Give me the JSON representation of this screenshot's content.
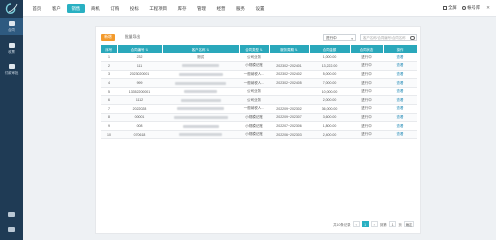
{
  "sidebar": {
    "items": [
      {
        "label": "合同",
        "icon": "contract-icon"
      },
      {
        "label": "收票",
        "icon": "invoice-icon"
      },
      {
        "label": "付款审批",
        "icon": "payment-icon"
      }
    ]
  },
  "nav": {
    "items": [
      "首页",
      "客户",
      "销售",
      "商机",
      "订购",
      "投标",
      "工程项目",
      "库存",
      "管理",
      "经营",
      "服务",
      "设置"
    ],
    "active_index": 2
  },
  "top_right": {
    "fullscreen": "全屏",
    "account": "帐号库"
  },
  "toolbar": {
    "add_label": "新增",
    "export_label": "批量导出"
  },
  "filter": {
    "status_value": "进行中"
  },
  "search": {
    "placeholder": "客户名称/合同编号/合同名称"
  },
  "table": {
    "columns": [
      "序号",
      "合同编号",
      "客户名称",
      "合同类型",
      "服务周期",
      "合同金额",
      "合同状态",
      "操作"
    ],
    "rows": [
      {
        "no": "1",
        "code": "232",
        "customer": "测试",
        "blur": false,
        "type": "公司业务",
        "period": "",
        "amount": "1,000.00",
        "status": "进行中",
        "op": "查看"
      },
      {
        "no": "2",
        "code": "111",
        "customer": "",
        "blur": true,
        "type": "小规模记账",
        "period": "202302~202401",
        "amount": "13,222.00",
        "status": "进行中",
        "op": "查看"
      },
      {
        "no": "3",
        "code": "2023020001",
        "customer": "",
        "blur": true,
        "type": "一般纳税人...",
        "period": "202302~202402",
        "amount": "5,000.00",
        "status": "进行中",
        "op": "查看"
      },
      {
        "no": "4",
        "code": "999",
        "customer": "",
        "blur": true,
        "type": "一般纳税人...",
        "period": "202302~202405",
        "amount": "7,000.00",
        "status": "进行中",
        "op": "查看"
      },
      {
        "no": "5",
        "code": "13352200001",
        "customer": "",
        "blur": true,
        "type": "公司业务",
        "period": "",
        "amount": "10,000.00",
        "status": "进行中",
        "op": "查看"
      },
      {
        "no": "6",
        "code": "1112",
        "customer": "",
        "blur": true,
        "type": "公司业务",
        "period": "",
        "amount": "2,000.00",
        "status": "进行中",
        "op": "查看"
      },
      {
        "no": "7",
        "code": "2022028",
        "customer": "",
        "blur": true,
        "type": "一般纳税人...",
        "period": "202209~202302",
        "amount": "36,000.00",
        "status": "进行中",
        "op": "查看"
      },
      {
        "no": "8",
        "code": "00001",
        "customer": "",
        "blur": true,
        "type": "小规模记账",
        "period": "202209~202307",
        "amount": "3,600.00",
        "status": "进行中",
        "op": "查看"
      },
      {
        "no": "9",
        "code": "008",
        "customer": "",
        "blur": true,
        "type": "小规模记账",
        "period": "202207~202306",
        "amount": "1,800.00",
        "status": "进行中",
        "op": "查看"
      },
      {
        "no": "10",
        "code": "070618",
        "customer": "",
        "blur": true,
        "type": "小规模记账",
        "period": "202206~202303",
        "amount": "2,400.00",
        "status": "进行中",
        "op": "查看"
      }
    ]
  },
  "pager": {
    "total_text": "共10条记录",
    "pages": [
      "1",
      "2",
      "3"
    ],
    "current": "1",
    "page_size": "10",
    "goto_label": "到第",
    "page_label": "页",
    "confirm_label": "确定"
  },
  "colors": {
    "accent": "#29b0c2",
    "sidebar": "#1f3b55",
    "orange": "#f39a2b"
  }
}
